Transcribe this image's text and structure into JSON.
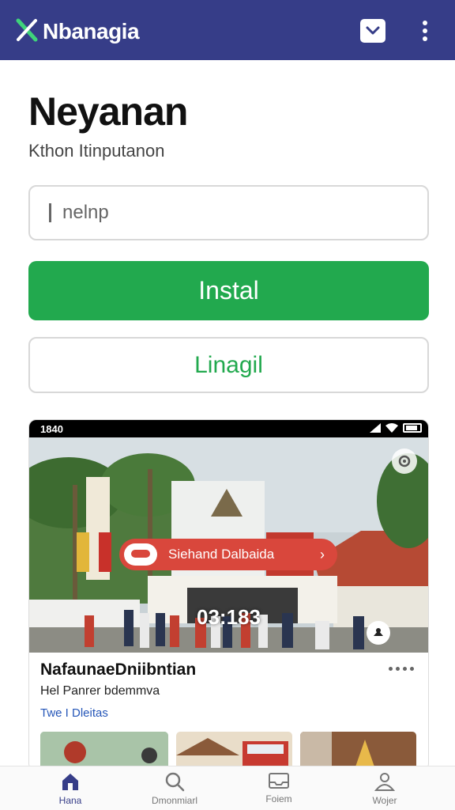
{
  "app": {
    "title": "Nbanagia",
    "brand_color": "#363d88",
    "accent_green": "#22a94e"
  },
  "header": {
    "title": "Neyanan",
    "subtitle": "Kthon Itinputanon"
  },
  "search": {
    "placeholder": "nelnp"
  },
  "buttons": {
    "install_label": "Instal",
    "secondary_label": "Linagil"
  },
  "card": {
    "status_time": "1840",
    "pill_label": "Siehand Dalbaida",
    "pill_arrow": "›",
    "timestamp": "03:183",
    "title": "NafaunaeDniibntian",
    "subtitle": "Hel Panrer bdemmva",
    "meta": "Twe I Dleitas",
    "icons": [
      "signal-icon",
      "wifi-icon",
      "battery-icon",
      "settings-icon",
      "share-icon",
      "more-icon"
    ]
  },
  "bottom_nav": {
    "items": [
      {
        "label": "Hana",
        "icon": "home-icon",
        "active": true
      },
      {
        "label": "Dmonmiarl",
        "icon": "search-icon",
        "active": false
      },
      {
        "label": "Foiem",
        "icon": "inbox-icon",
        "active": false
      },
      {
        "label": "Wojer",
        "icon": "profile-icon",
        "active": false
      }
    ]
  }
}
